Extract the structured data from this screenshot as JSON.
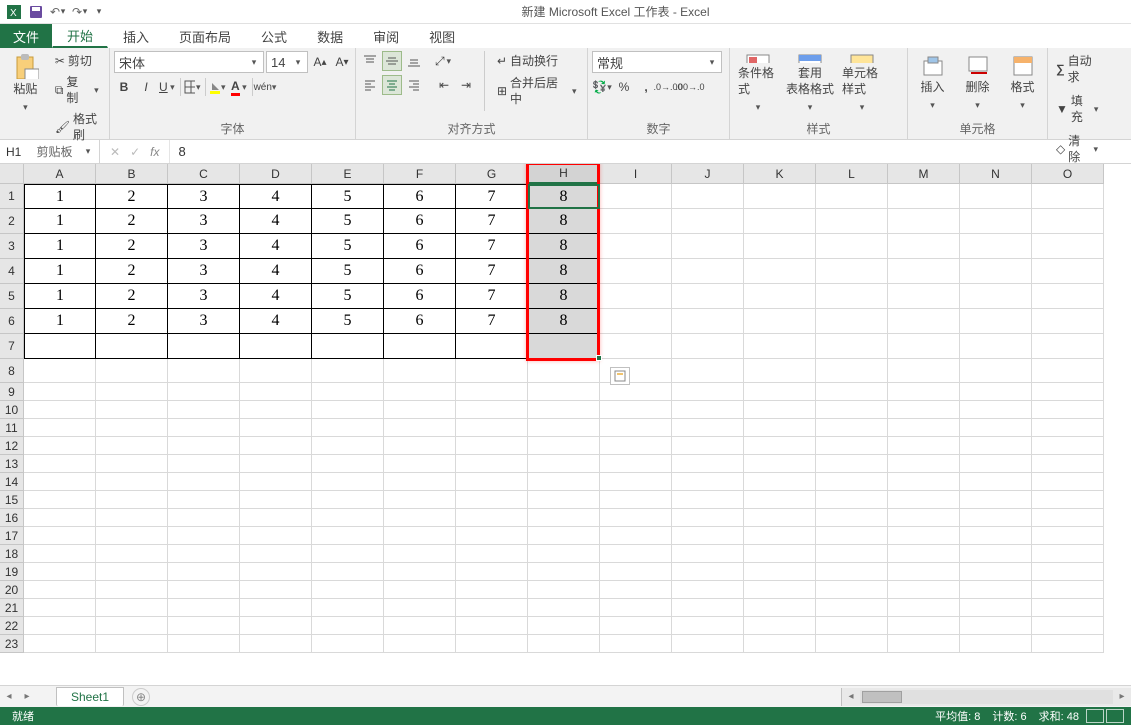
{
  "window": {
    "title": "新建 Microsoft Excel 工作表 - Excel"
  },
  "qat": {
    "save_icon": "save",
    "undo_icon": "undo",
    "redo_icon": "redo"
  },
  "tabs": {
    "file": "文件",
    "items": [
      "开始",
      "插入",
      "页面布局",
      "公式",
      "数据",
      "审阅",
      "视图"
    ],
    "active_index": 0
  },
  "ribbon": {
    "clipboard": {
      "paste": "粘贴",
      "cut": "剪切",
      "copy": "复制",
      "format_painter": "格式刷",
      "title": "剪贴板"
    },
    "font": {
      "name": "宋体",
      "size": "14",
      "bold": "B",
      "italic": "I",
      "underline": "U",
      "title": "字体",
      "ruby": "wén"
    },
    "align": {
      "wrap": "自动换行",
      "merge": "合并后居中",
      "title": "对齐方式"
    },
    "number": {
      "format": "常规",
      "percent": "%",
      "comma": ",",
      "title": "数字"
    },
    "styles": {
      "cond": "条件格式",
      "table": "套用\n表格格式",
      "cell": "单元格样式",
      "title": "样式"
    },
    "cells": {
      "insert": "插入",
      "delete": "删除",
      "format": "格式",
      "title": "单元格"
    },
    "editing": {
      "autosum": "自动求",
      "fill": "填充",
      "clear": "清除"
    }
  },
  "fxbar": {
    "namebox": "H1",
    "fx_label": "fx",
    "formula": "8"
  },
  "sheet": {
    "columns": [
      "A",
      "B",
      "C",
      "D",
      "E",
      "F",
      "G",
      "H",
      "I",
      "J",
      "K",
      "L",
      "M",
      "N",
      "O"
    ],
    "row_headers": [
      1,
      2,
      3,
      4,
      5,
      6,
      7,
      8,
      9,
      10,
      11,
      12,
      13,
      14,
      15,
      16,
      17,
      18,
      19,
      20,
      21,
      22,
      23
    ],
    "selected_col_index": 7,
    "data_rows": [
      [
        1,
        2,
        3,
        4,
        5,
        6,
        7,
        8
      ],
      [
        1,
        2,
        3,
        4,
        5,
        6,
        7,
        8
      ],
      [
        1,
        2,
        3,
        4,
        5,
        6,
        7,
        8
      ],
      [
        1,
        2,
        3,
        4,
        5,
        6,
        7,
        8
      ],
      [
        1,
        2,
        3,
        4,
        5,
        6,
        7,
        8
      ],
      [
        1,
        2,
        3,
        4,
        5,
        6,
        7,
        8
      ]
    ],
    "bordered_cols": 8,
    "bordered_rows": 7,
    "highlight_col": 7,
    "selected_range_rows": 7,
    "sheet_tab": "Sheet1"
  },
  "status": {
    "ready": "就绪",
    "avg": "平均值: 8",
    "count": "计数: 6",
    "sum": "求和: 48"
  }
}
